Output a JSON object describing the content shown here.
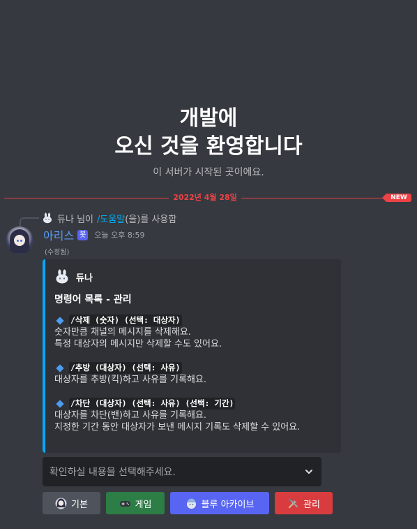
{
  "welcome": {
    "title_line1": "개발에",
    "title_line2": "오신 것을 환영합니다",
    "subtitle": "이 서버가 시작된 곳이에요."
  },
  "divider": {
    "date": "2022년 4월 28일",
    "new_label": "NEW"
  },
  "reply": {
    "user": "듀나",
    "suffix": "님이",
    "command": "/도움말",
    "tail": "(을)를 사용함"
  },
  "message": {
    "author": "아리스",
    "bot_badge": "봇",
    "timestamp": "오늘 오후 8:59",
    "edited": "(수정됨)"
  },
  "embed": {
    "accent_color": "#00a8fc",
    "author_name": "듀나",
    "title": "명령어 목록 - 관리",
    "fields": [
      {
        "command": "/삭제 (숫자) (선택: 대상자)",
        "lines": [
          "숫자만큼 채널의 메시지를 삭제해요.",
          "특정 대상자의 메시지만 삭제할 수도 있어요."
        ]
      },
      {
        "command": "/추방 (대상자) (선택: 사유)",
        "lines": [
          "대상자를 추방(킥)하고 사유를 기록해요."
        ]
      },
      {
        "command": "/차단 (대상자) (선택: 사유) (선택: 기간)",
        "lines": [
          "대상자를 차단(밴)하고 사유를 기록해요.",
          "지정한 기간 동안 대상자가 보낸 메시지 기록도 삭제할 수 있어요."
        ]
      }
    ]
  },
  "select_menu": {
    "placeholder": "확인하실 내용을 선택해주세요.",
    "icon": "chevron-down-icon"
  },
  "buttons": [
    {
      "label": "기본",
      "icon": "avatar-icon",
      "color": "#4f545c"
    },
    {
      "label": "게임",
      "icon": "gamepad-icon",
      "color": "#2d7d46"
    },
    {
      "label": "블루 아카이브",
      "icon": "archive-character-icon",
      "color": "#5865f2"
    },
    {
      "label": "관리",
      "icon": "tools-icon",
      "color": "#d83c3e"
    }
  ]
}
